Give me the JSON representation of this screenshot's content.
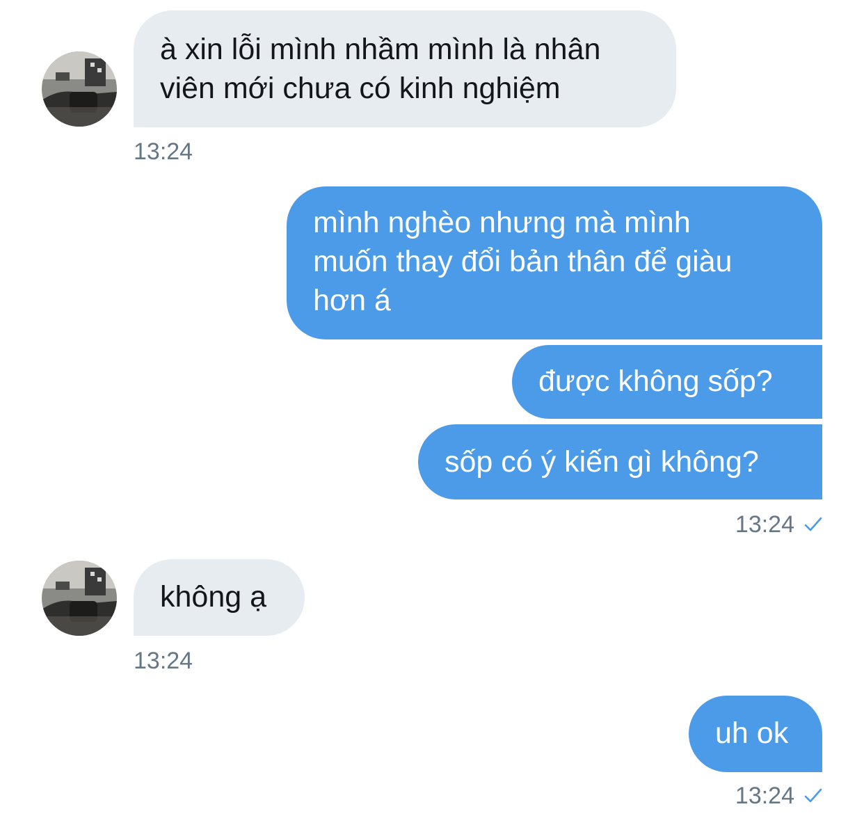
{
  "conversation": {
    "messages": [
      {
        "direction": "incoming",
        "lines": [
          "à xin lỗi mình nhầm mình là nhân",
          "viên mới chưa có kinh nghiệm"
        ]
      },
      {
        "timestamp": "13:24"
      },
      {
        "direction": "outgoing",
        "lines": [
          "mình nghèo nhưng mà mình",
          "muốn thay đổi bản thân để giàu",
          "hơn á"
        ]
      },
      {
        "direction": "outgoing",
        "lines": [
          "được không sốp?"
        ]
      },
      {
        "direction": "outgoing",
        "lines": [
          "sốp có ý kiến gì không?"
        ]
      },
      {
        "timestamp": "13:24",
        "status_icon": "check-icon"
      },
      {
        "direction": "incoming",
        "lines": [
          "không ạ"
        ]
      },
      {
        "timestamp": "13:24"
      },
      {
        "direction": "outgoing",
        "lines": [
          "uh ok"
        ]
      },
      {
        "timestamp": "13:24",
        "status_icon": "check-icon"
      }
    ]
  },
  "colors": {
    "incoming_bubble": "#e6ecf0",
    "outgoing_bubble": "#4c9be8",
    "timestamp_text": "#657786",
    "check": "#4c9be8"
  }
}
